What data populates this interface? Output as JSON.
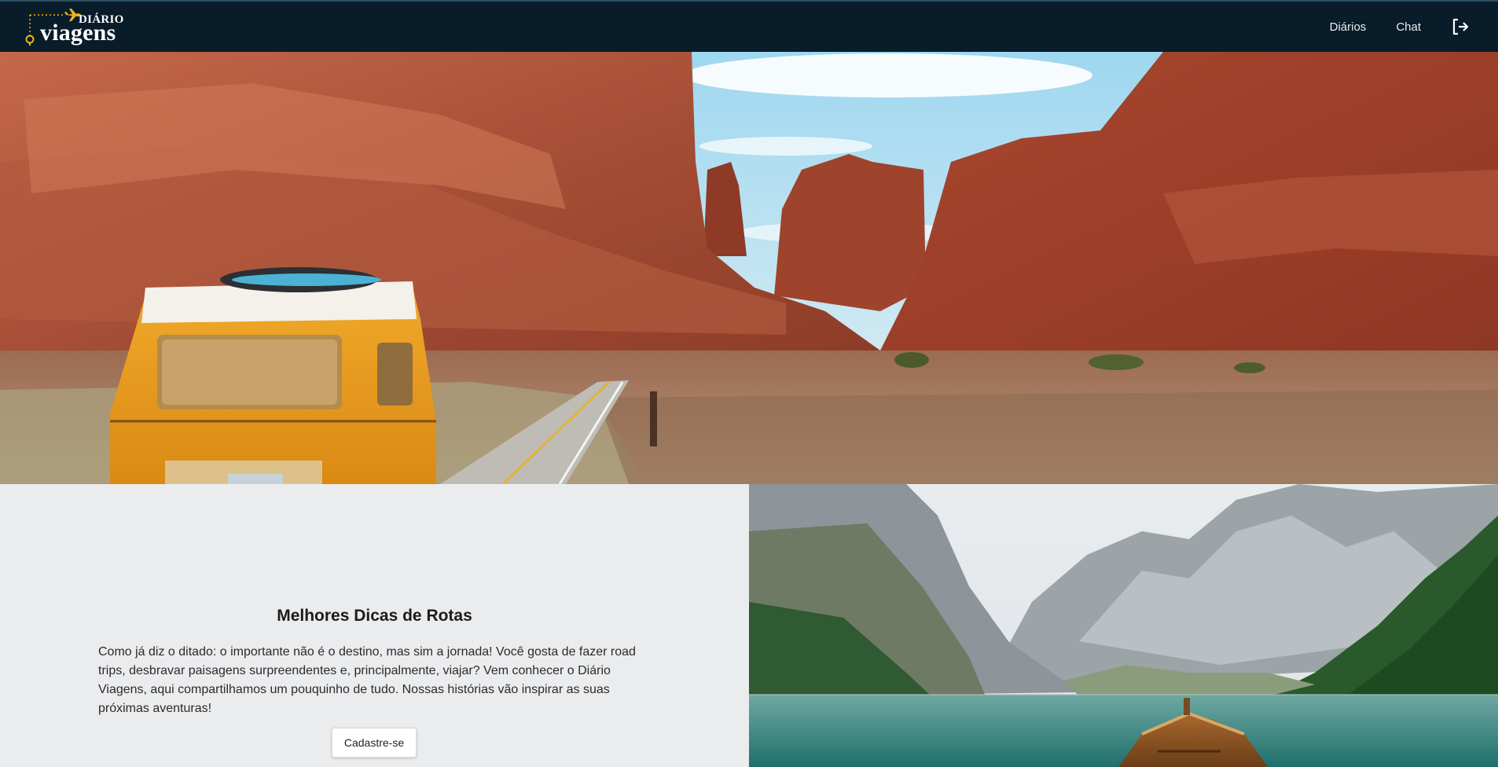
{
  "brand": {
    "line1": "DIÁRIO",
    "line2": "viagens",
    "icons": [
      "airplane-icon",
      "location-pin-icon"
    ],
    "accent_color": "#f2b418"
  },
  "nav": {
    "links": [
      {
        "label": "Diários"
      },
      {
        "label": "Chat"
      }
    ],
    "logout_icon": "logout-icon",
    "background": "#081c29"
  },
  "hero": {
    "image": "desert-canyon-road-with-yellow-van"
  },
  "info": {
    "title": "Melhores Dicas de Rotas",
    "text": "Como já diz o ditado: o importante não é o destino, mas sim a jornada! Você gosta de fazer road trips, desbravar paisagens surpreendentes e, principalmente, viajar? Vem conhecer o Diário Viagens, aqui compartilhamos um pouquinho de tudo. Nossas histórias vão inspirar as suas próximas aventuras!",
    "button_label": "Cadastre-se"
  },
  "lake": {
    "image": "mountain-lake-with-wooden-boat"
  }
}
